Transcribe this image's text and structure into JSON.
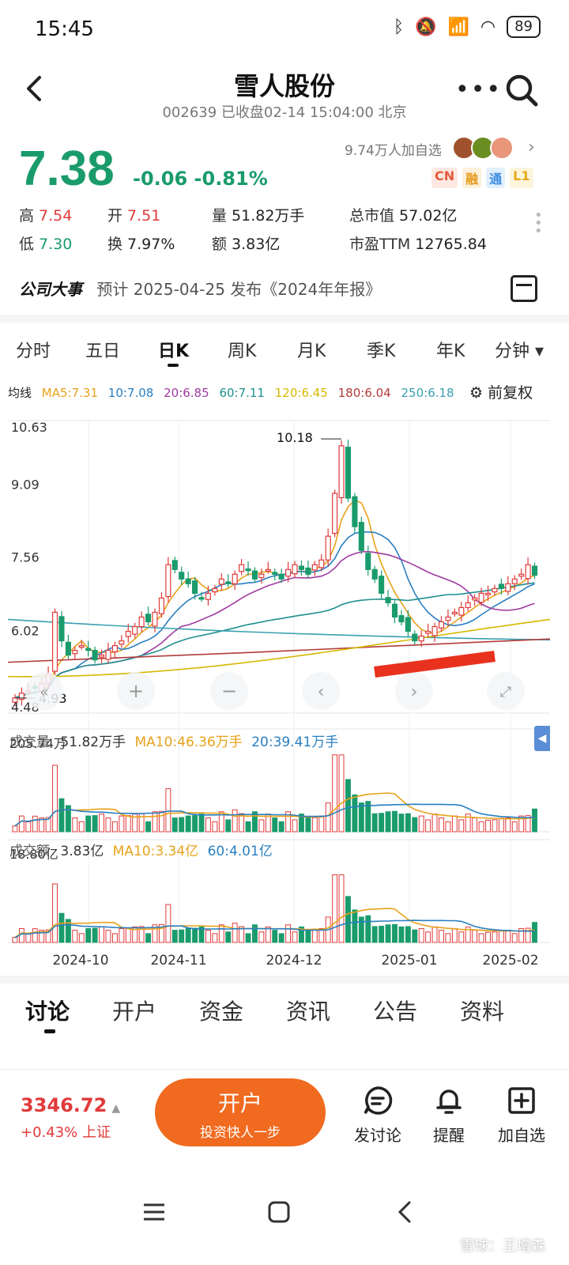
{
  "status": {
    "time": "15:45",
    "battery": "89"
  },
  "header": {
    "title": "雪人股份",
    "subtitle": "002639 已收盘02-14 15:04:00 北京"
  },
  "quote": {
    "price": "7.38",
    "change": "-0.06 -0.81%",
    "followers": "9.74万人加自选",
    "tags": [
      "CN",
      "融",
      "通",
      "L1"
    ],
    "high_label": "高",
    "high": "7.54",
    "open_label": "开",
    "open": "7.51",
    "vol_label": "量",
    "vol": "51.82万手",
    "mcap_label": "总市值",
    "mcap": "57.02亿",
    "low_label": "低",
    "low": "7.30",
    "turnover_label": "换",
    "turnover": "7.97%",
    "amount_label": "额",
    "amount": "3.83亿",
    "pe_label": "市盈TTM",
    "pe": "12765.84"
  },
  "event": {
    "title": "公司大事",
    "text": "预计 2025-04-25 发布《2024年年报》"
  },
  "chart_tabs": [
    "分时",
    "五日",
    "日K",
    "周K",
    "月K",
    "季K",
    "年K",
    "分钟 ▾"
  ],
  "ma": {
    "label": "均线",
    "ma5": "MA5:7.31",
    "ma10": "10:7.08",
    "ma20": "20:6.85",
    "ma60": "60:7.11",
    "ma120": "120:6.45",
    "ma180": "180:6.04",
    "ma250": "250:6.18",
    "fq": "前复权"
  },
  "chart_data": {
    "type": "candlestick",
    "y_ticks": [
      "10.63",
      "9.09",
      "7.56",
      "6.02",
      "4.48"
    ],
    "ylim": [
      4.48,
      10.63
    ],
    "max_label": "10.18",
    "min_label": "4.93",
    "x_labels": [
      "2024-10",
      "2024-11",
      "2024-12",
      "2025-01",
      "2025-02"
    ],
    "closes": [
      4.8,
      4.9,
      4.95,
      5.0,
      5.1,
      5.3,
      6.6,
      6.0,
      5.7,
      5.8,
      5.9,
      5.8,
      5.6,
      5.7,
      5.8,
      5.9,
      6.0,
      6.2,
      6.3,
      6.5,
      6.4,
      6.6,
      6.9,
      7.6,
      7.5,
      7.3,
      7.2,
      7.0,
      6.9,
      7.0,
      7.1,
      7.3,
      7.2,
      7.4,
      7.6,
      7.5,
      7.3,
      7.4,
      7.5,
      7.4,
      7.3,
      7.5,
      7.6,
      7.5,
      7.4,
      7.6,
      7.7,
      8.2,
      9.1,
      10.1,
      9.0,
      8.4,
      7.9,
      7.5,
      7.3,
      7.0,
      6.8,
      6.5,
      6.4,
      6.2,
      6.0,
      6.1,
      6.2,
      6.3,
      6.4,
      6.5,
      6.6,
      6.7,
      6.8,
      6.9,
      7.0,
      7.0,
      7.1,
      7.1,
      7.2,
      7.3,
      7.4,
      7.6,
      7.38
    ],
    "volume": {
      "label": "成交量",
      "value": "51.82万手",
      "ma10": "MA10:46.36万手",
      "ma20": "20:39.41万手",
      "max": "205.74万"
    },
    "amount": {
      "label": "成交额",
      "value": "3.83亿",
      "ma10": "MA10:3.34亿",
      "ma60": "60:4.01亿",
      "max": "18.80亿"
    }
  },
  "tabs": [
    "讨论",
    "开户",
    "资金",
    "资讯",
    "公告",
    "资料"
  ],
  "bottom": {
    "index_value": "3346.72",
    "index_change": "+0.43% 上证",
    "kaihu_title": "开户",
    "kaihu_sub": "投资快人一步",
    "post": "发讨论",
    "alert": "提醒",
    "add": "加自选"
  },
  "watermark": "雪球：王增森"
}
